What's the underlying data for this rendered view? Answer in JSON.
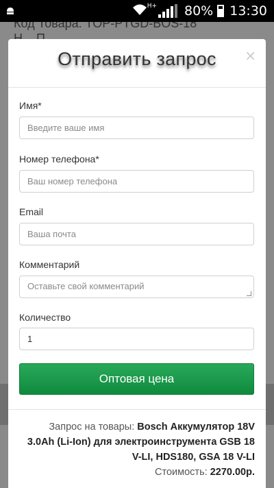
{
  "status_bar": {
    "network": "H+",
    "battery_percent": "80%",
    "time": "13:30",
    "icons": [
      "android-notification-icon",
      "wifi-icon",
      "signal-icon",
      "battery-icon"
    ]
  },
  "background_page": {
    "product_code": "Код Товара: TOP-PTGD-BOS-18",
    "partial_line": "Н...    П..."
  },
  "modal": {
    "title": "Отправить запрос",
    "close_glyph": "×",
    "fields": {
      "name": {
        "label": "Имя*",
        "placeholder": "Введите ваше имя",
        "value": ""
      },
      "phone": {
        "label": "Номер телефона*",
        "placeholder": "Ваш номер телефона",
        "value": ""
      },
      "email": {
        "label": "Email",
        "placeholder": "Ваша почта",
        "value": ""
      },
      "comment": {
        "label": "Комментарий",
        "placeholder": "Оставьте свой комментарий",
        "value": ""
      },
      "quantity": {
        "label": "Количество",
        "placeholder": "",
        "value": "1"
      }
    },
    "submit_label": "Оптовая цена",
    "footer": {
      "request_prefix": "Запрос на товары:",
      "product_name": "Bosch Аккумулятор 18V 3.0Ah (Li-Ion) для электроинструмента GSB 18 V-LI, HDS180, GSA 18 V-LI",
      "price_label": "Стоимость:",
      "price_value": "2270.00р."
    }
  },
  "colors": {
    "submit_button": "#1a9a4a",
    "overlay": "#7a7a7a"
  }
}
